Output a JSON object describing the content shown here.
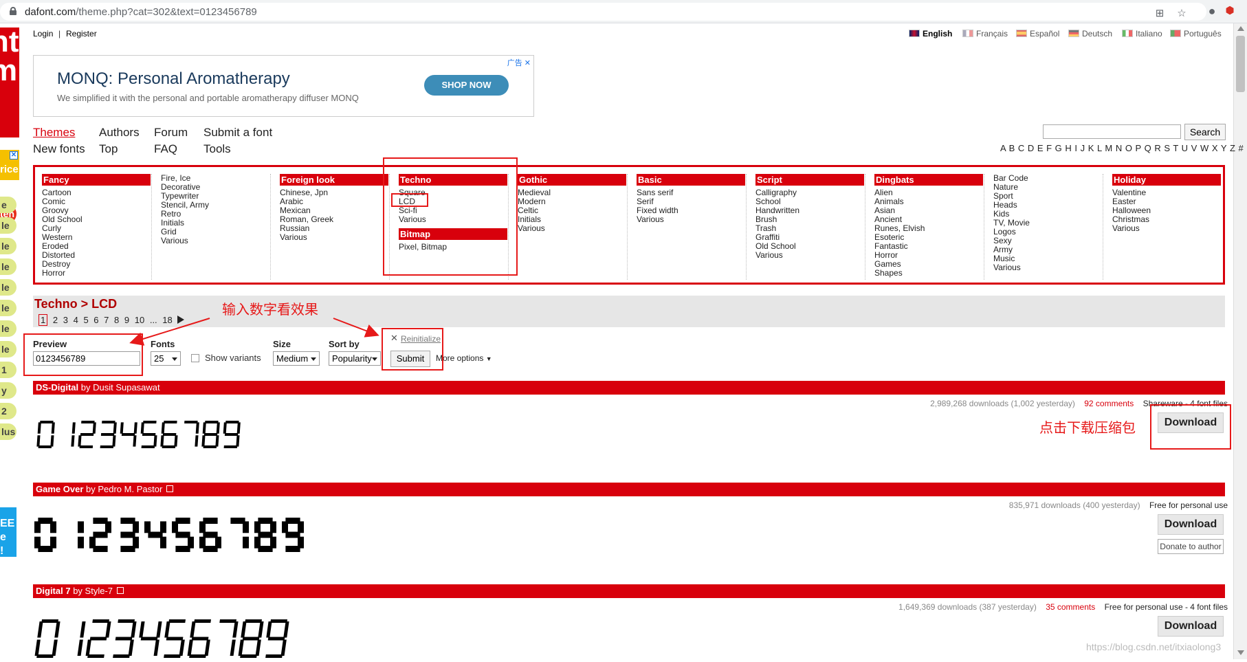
{
  "browser": {
    "url_host": "dafont.com",
    "url_path": "/theme.php?cat=302&text=0123456789"
  },
  "side": {
    "ad_text": "rice",
    "red_badge": "ten",
    "items": [
      "e",
      "le",
      "le",
      "le",
      "le",
      "le",
      "le",
      "le",
      "1",
      "y",
      "2",
      "lus"
    ],
    "blue_lines": [
      "EE",
      "e",
      "!"
    ]
  },
  "topbar": {
    "login": "Login",
    "register": "Register",
    "languages": [
      "English",
      "Français",
      "Español",
      "Deutsch",
      "Italiano",
      "Português"
    ]
  },
  "ad": {
    "title": "MONQ: Personal Aromatherapy",
    "desc": "We simplified it with the personal and portable aromatherapy diffuser MONQ",
    "button": "SHOP NOW",
    "label": "广告 ✕"
  },
  "nav": {
    "themes": "Themes",
    "authors": "Authors",
    "forum": "Forum",
    "submit": "Submit a font",
    "new_fonts": "New fonts",
    "top": "Top",
    "faq": "FAQ",
    "tools": "Tools",
    "search_button": "Search",
    "alphabet": "A B C D E F G H I J K L M N O P Q R S T U V W X Y Z #"
  },
  "themes": {
    "fancy": {
      "title": "Fancy",
      "items": [
        "Cartoon",
        "Comic",
        "Groovy",
        "Old School",
        "Curly",
        "Western",
        "Eroded",
        "Distorted",
        "Destroy",
        "Horror"
      ]
    },
    "misc": {
      "items": [
        "Fire, Ice",
        "Decorative",
        "Typewriter",
        "Stencil, Army",
        "Retro",
        "Initials",
        "Grid",
        "Various"
      ]
    },
    "foreign": {
      "title": "Foreign look",
      "items": [
        "Chinese, Jpn",
        "Arabic",
        "Mexican",
        "Roman, Greek",
        "Russian",
        "Various"
      ]
    },
    "techno": {
      "title": "Techno",
      "items": [
        "Square",
        "LCD",
        "Sci-fi",
        "Various"
      ]
    },
    "bitmap": {
      "title": "Bitmap",
      "items": [
        "Pixel, Bitmap"
      ]
    },
    "gothic": {
      "title": "Gothic",
      "items": [
        "Medieval",
        "Modern",
        "Celtic",
        "Initials",
        "Various"
      ]
    },
    "basic": {
      "title": "Basic",
      "items": [
        "Sans serif",
        "Serif",
        "Fixed width",
        "Various"
      ]
    },
    "script": {
      "title": "Script",
      "items": [
        "Calligraphy",
        "School",
        "Handwritten",
        "Brush",
        "Trash",
        "Graffiti",
        "Old School",
        "Various"
      ]
    },
    "dingbats": {
      "title": "Dingbats",
      "items": [
        "Alien",
        "Animals",
        "Asian",
        "Ancient",
        "Runes, Elvish",
        "Esoteric",
        "Fantastic",
        "Horror",
        "Games",
        "Shapes"
      ]
    },
    "misc2": {
      "items": [
        "Bar Code",
        "Nature",
        "Sport",
        "Heads",
        "Kids",
        "TV, Movie",
        "Logos",
        "Sexy",
        "Army",
        "Music",
        "Various"
      ]
    },
    "holiday": {
      "title": "Holiday",
      "items": [
        "Valentine",
        "Easter",
        "Halloween",
        "Christmas",
        "Various"
      ]
    }
  },
  "breadcrumb": "Techno > LCD",
  "pager": {
    "current": "1",
    "pages": [
      "2",
      "3",
      "4",
      "5",
      "6",
      "7",
      "8",
      "9",
      "10",
      "...",
      "18"
    ]
  },
  "form": {
    "preview_label": "Preview",
    "preview_value": "0123456789",
    "fonts_label": "Fonts",
    "fonts_value": "25",
    "show_variants": "Show variants",
    "size_label": "Size",
    "size_value": "Medium",
    "sort_label": "Sort by",
    "sort_value": "Popularity",
    "reinitialize": "Reinitialize",
    "submit": "Submit",
    "more_options": "More options"
  },
  "annotations": {
    "input_hint": "输入数字看效果",
    "download_hint": "点击下载压缩包"
  },
  "fonts": [
    {
      "name": "DS-Digital",
      "by": "by Dusit Supasawat",
      "downloads": "2,989,268 downloads (1,002 yesterday)",
      "comments": "92 comments",
      "license": "Shareware - 4 font files",
      "download": "Download"
    },
    {
      "name": "Game Over",
      "by": "by Pedro M. Pastor",
      "downloads": "835,971 downloads (400 yesterday)",
      "comments": "",
      "license": "Free for personal use",
      "download": "Download",
      "donate": "Donate to author"
    },
    {
      "name": "Digital 7",
      "by": "by Style-7",
      "downloads": "1,649,369 downloads (387 yesterday)",
      "comments": "35 comments",
      "license": "Free for personal use - 4 font files",
      "download": "Download"
    }
  ],
  "sample_text": "0123456789",
  "watermark": "https://blog.csdn.net/itxiaolong3",
  "colors": {
    "brand": "#d8000c",
    "annotation": "#e61919"
  }
}
